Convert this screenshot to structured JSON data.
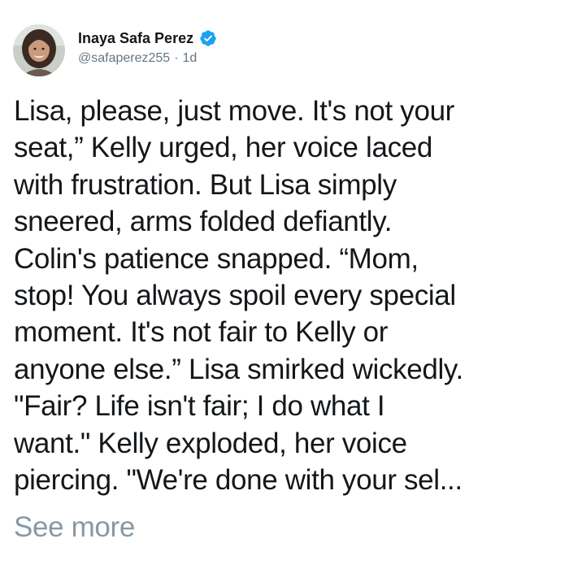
{
  "author": {
    "display_name": "Inaya Safa Perez",
    "handle": "@safaperez255",
    "separator": "·",
    "timestamp": "1d",
    "verified_icon": "verified-badge-icon",
    "avatar_icon": "profile-avatar"
  },
  "tweet": {
    "lines": [
      "Lisa, please, just move. It's not your",
      "seat,” Kelly urged, her voice laced",
      "with frustration. But Lisa simply",
      "sneered, arms folded defiantly.",
      "Colin's patience snapped. “Mom,",
      "stop! You always spoil every special",
      "moment. It's not fair to Kelly or",
      "anyone else.” Lisa smirked wickedly.",
      "\"Fair? Life isn't fair; I do what I",
      "want.\" Kelly exploded, her voice",
      "piercing. \"We're done with your sel..."
    ],
    "see_more_label": "See more"
  },
  "colors": {
    "text": "#14171a",
    "secondary": "#657786",
    "see_more": "#8899a6",
    "verified": "#1da1f2"
  }
}
